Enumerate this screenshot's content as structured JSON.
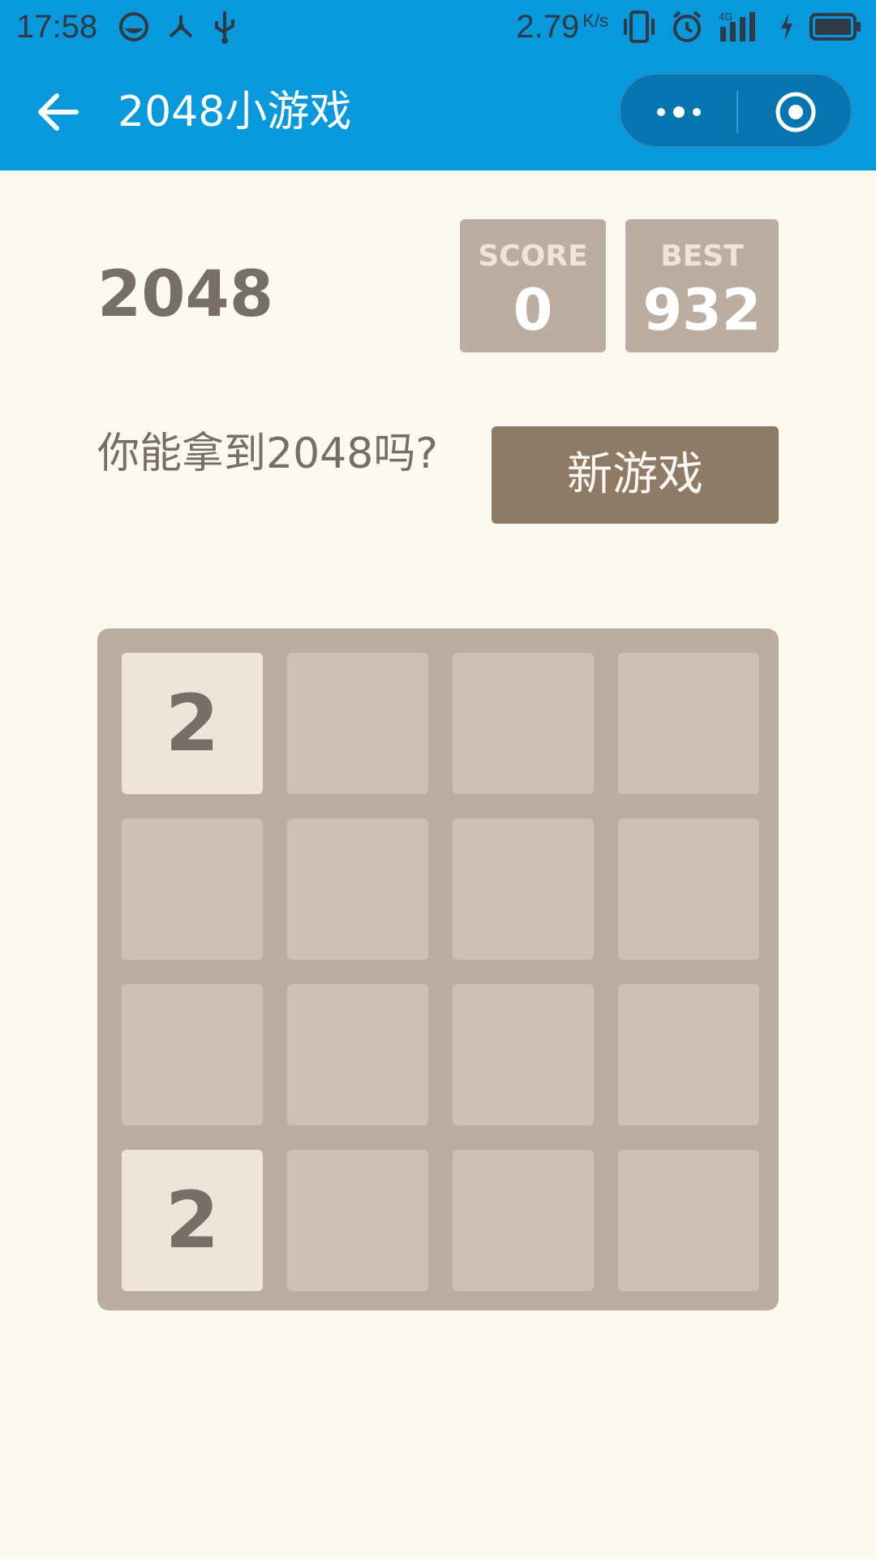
{
  "status_bar": {
    "time": "17:58",
    "speed_value": "2.79",
    "speed_unit": "K/s",
    "network": "4G"
  },
  "app_bar": {
    "title": "2048小游戏"
  },
  "game": {
    "title": "2048",
    "score_label": "SCORE",
    "score_value": "0",
    "best_label": "BEST",
    "best_value": "932",
    "tagline": "你能拿到2048吗?",
    "new_game_label": "新游戏"
  },
  "board": {
    "rows": 4,
    "cols": 4,
    "tiles": [
      {
        "row": 0,
        "col": 0,
        "value": "2"
      },
      {
        "row": 3,
        "col": 0,
        "value": "2"
      }
    ]
  },
  "colors": {
    "app_bar": "#0899dd",
    "page_bg": "#faf8ef",
    "board_bg": "#bbada0",
    "empty_cell": "#cdc1b4",
    "tile_2": "#eee4da",
    "new_game_button": "#8f7a66",
    "text_dark": "#776e65"
  }
}
